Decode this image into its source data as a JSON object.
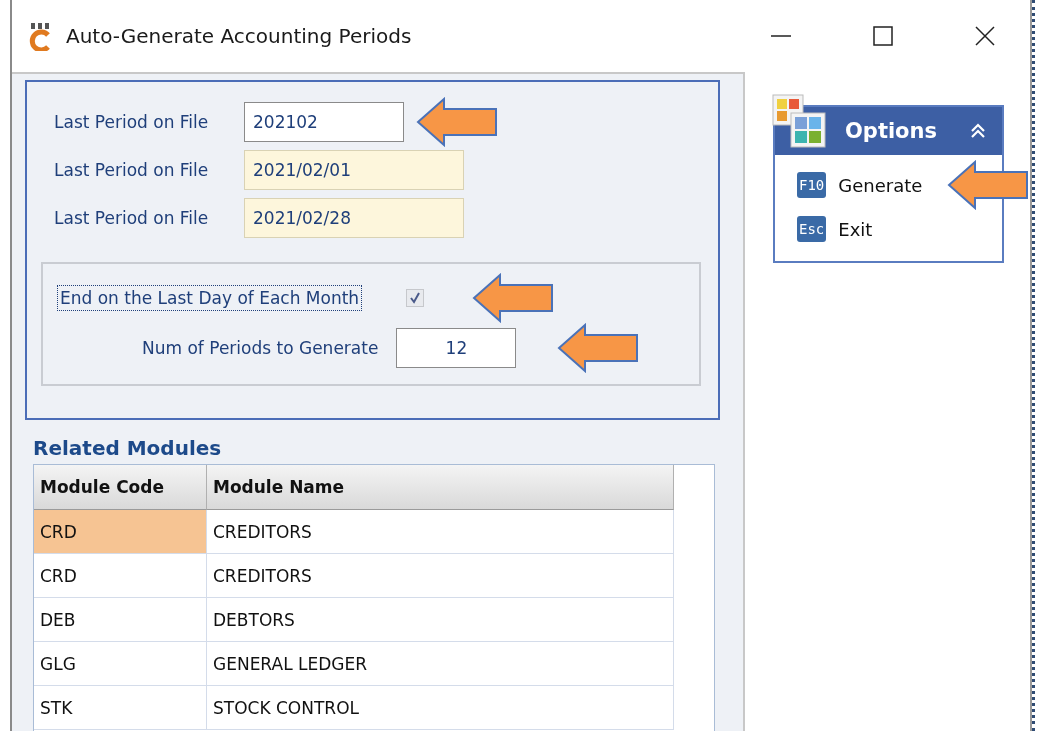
{
  "window": {
    "title": "Auto-Generate Accounting Periods"
  },
  "fields": [
    {
      "label": "Last Period on File",
      "value": "202102",
      "readonly": false,
      "annotated": true
    },
    {
      "label": "Last Period on File",
      "value": "2021/02/01",
      "readonly": true,
      "annotated": false
    },
    {
      "label": "Last Period on File",
      "value": "2021/02/28",
      "readonly": true,
      "annotated": false
    }
  ],
  "checkbox": {
    "label": "End on the Last Day of Each Month",
    "checked": true,
    "focused": true,
    "annotated": true
  },
  "num_periods": {
    "label": "Num of Periods to Generate",
    "value": "12",
    "annotated": true
  },
  "related_modules": {
    "title": "Related Modules",
    "columns": [
      "Module Code",
      "Module Name"
    ],
    "rows": [
      {
        "cells": [
          "CRD",
          "CREDITORS"
        ],
        "selected": true
      },
      {
        "cells": [
          "CRD",
          "CREDITORS"
        ],
        "selected": false
      },
      {
        "cells": [
          "DEB",
          "DEBTORS"
        ],
        "selected": false
      },
      {
        "cells": [
          "GLG",
          "GENERAL LEDGER"
        ],
        "selected": false
      },
      {
        "cells": [
          "STK",
          "STOCK CONTROL"
        ],
        "selected": false
      }
    ]
  },
  "options": {
    "title": "Options",
    "expanded": true,
    "items": [
      {
        "key": "F10",
        "label": "Generate",
        "annotated": true
      },
      {
        "key": "Esc",
        "label": "Exit",
        "annotated": false
      }
    ]
  }
}
